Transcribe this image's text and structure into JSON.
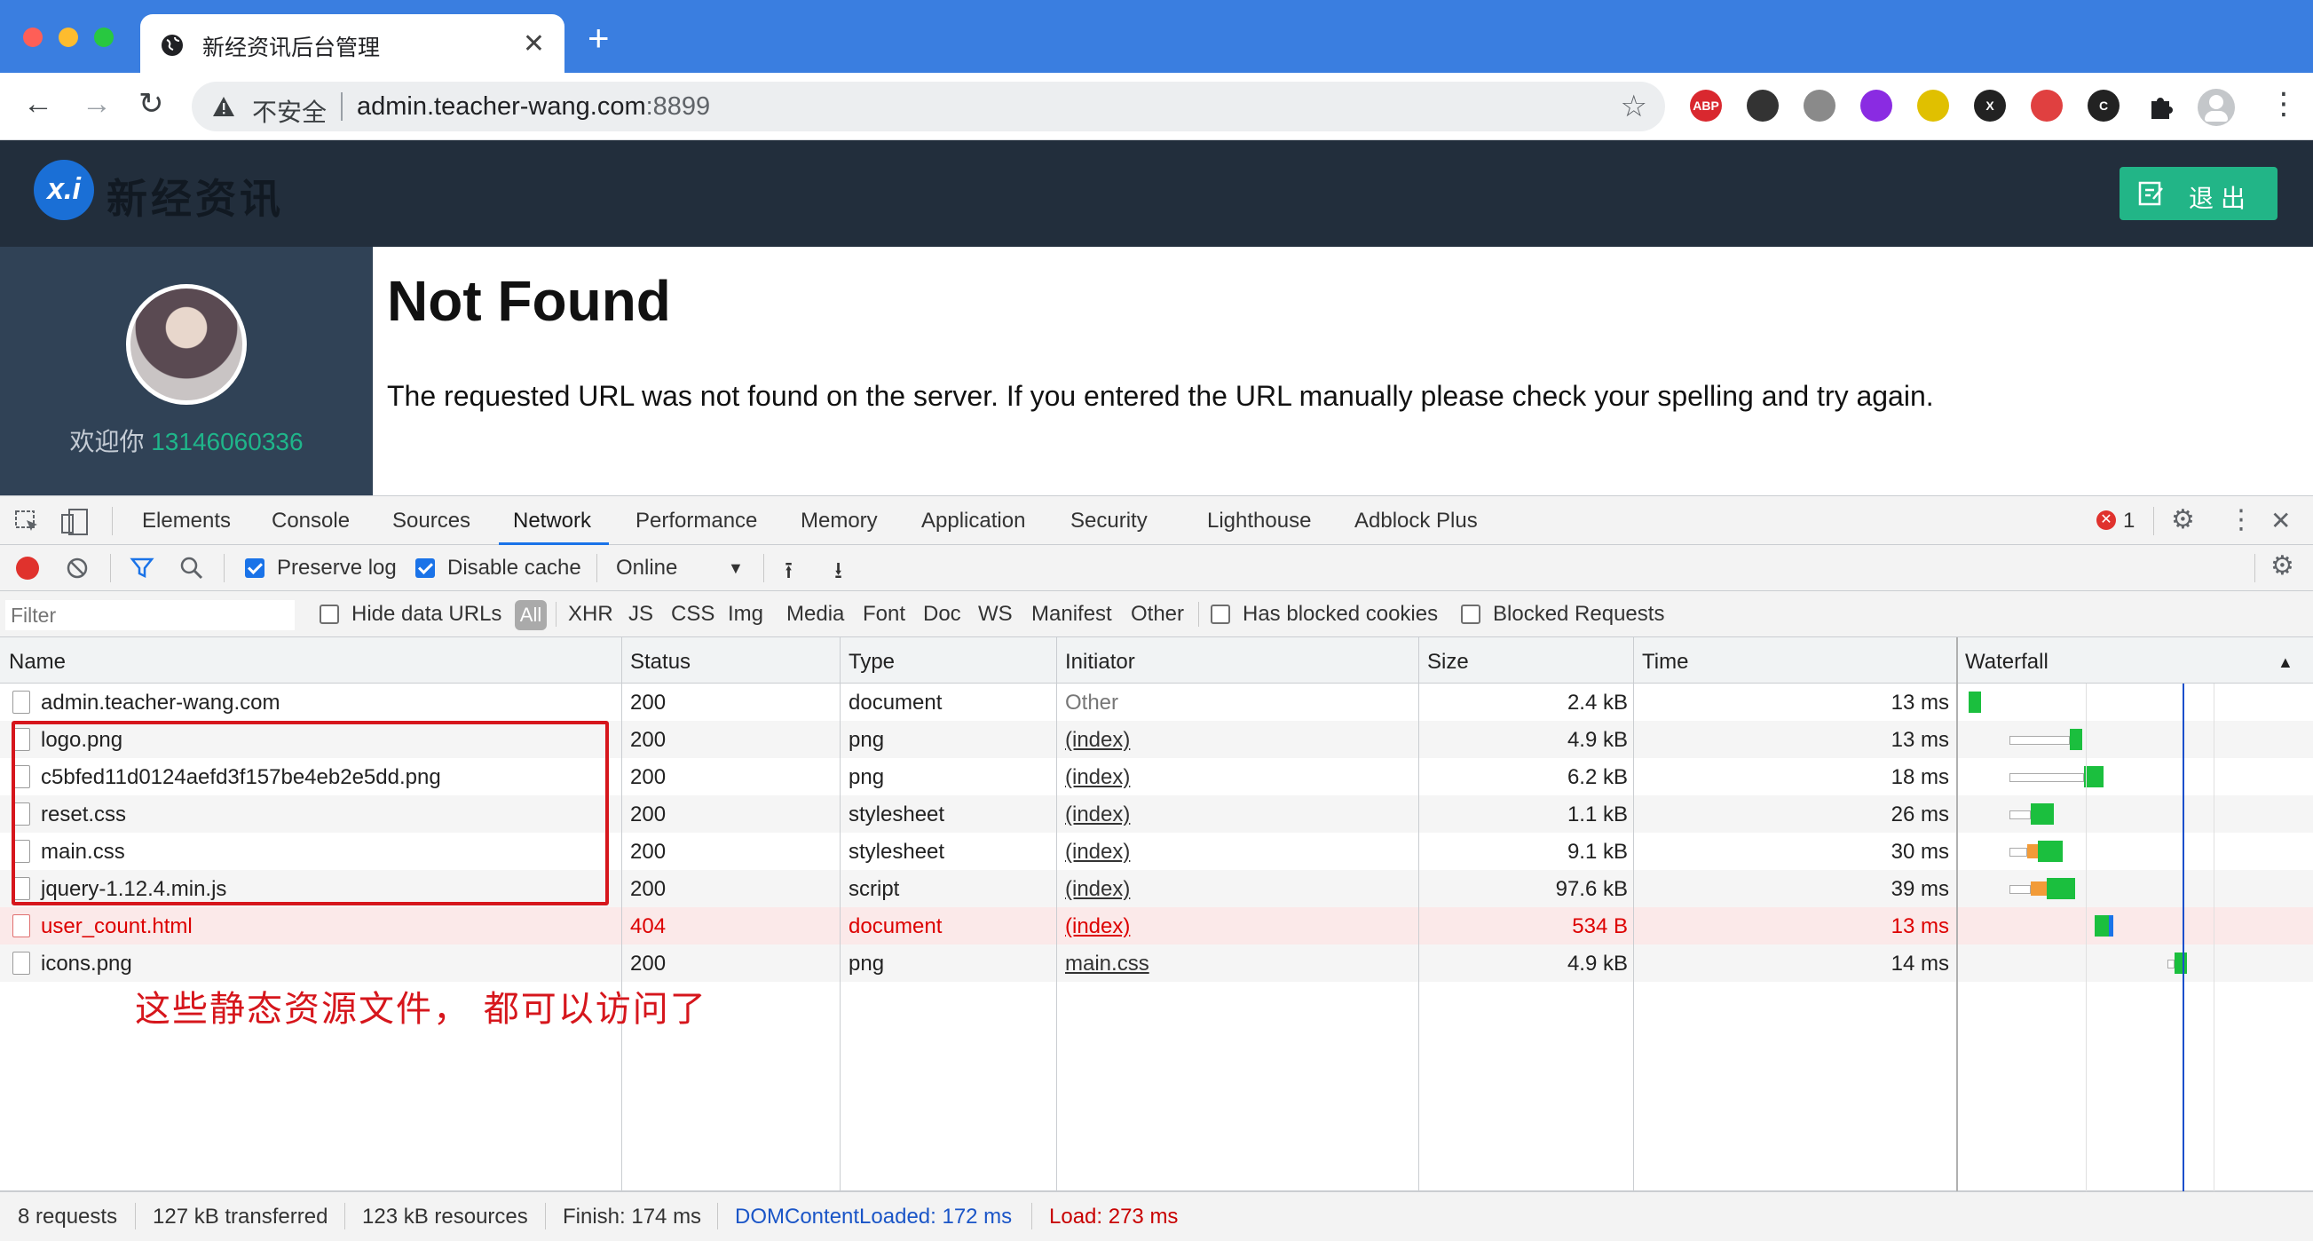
{
  "browser": {
    "tab_title": "新经资讯后台管理",
    "new_tab": "+",
    "insecure_label": "不安全",
    "url_host": "admin.teacher-wang.com",
    "url_port": ":8899",
    "extensions": [
      {
        "name": "adblock-plus-icon",
        "text": "ABP",
        "color": "#d9282f"
      },
      {
        "name": "qr-code-icon",
        "text": "",
        "color": "#333333"
      },
      {
        "name": "globe-extension-icon",
        "text": "",
        "color": "#8a8a8a"
      },
      {
        "name": "purple-extension-icon",
        "text": "",
        "color": "#8a2be2"
      },
      {
        "name": "lightning-extension-icon",
        "text": "",
        "color": "#e0c000"
      },
      {
        "name": "x-extension-icon",
        "text": "X",
        "color": "#222222"
      },
      {
        "name": "translate-extension-icon",
        "text": "",
        "color": "#e04040"
      },
      {
        "name": "c-extension-icon",
        "text": "C",
        "color": "#222222"
      }
    ]
  },
  "site": {
    "logo_badge": "x.i",
    "logo_text": "新经资讯",
    "logout_label": "退出",
    "welcome_prefix": "欢迎你 ",
    "welcome_phone": "13146060336",
    "error_title": "Not Found",
    "error_message": "The requested URL was not found on the server. If you entered the URL manually please check your spelling and try again."
  },
  "devtools": {
    "tabs": [
      "Elements",
      "Console",
      "Sources",
      "Network",
      "Performance",
      "Memory",
      "Application",
      "Security",
      "Lighthouse",
      "Adblock Plus"
    ],
    "active_tab": "Network",
    "error_count": "1",
    "toolbar": {
      "preserve_log": "Preserve log",
      "disable_cache": "Disable cache",
      "throttle": "Online"
    },
    "filter": {
      "placeholder": "Filter",
      "hide_data_urls": "Hide data URLs",
      "all": "All",
      "types": [
        "XHR",
        "JS",
        "CSS",
        "Img",
        "Media",
        "Font",
        "Doc",
        "WS",
        "Manifest",
        "Other"
      ],
      "has_blocked_cookies": "Has blocked cookies",
      "blocked_requests": "Blocked Requests"
    },
    "columns": [
      "Name",
      "Status",
      "Type",
      "Initiator",
      "Size",
      "Time",
      "Waterfall"
    ],
    "requests": [
      {
        "name": "admin.teacher-wang.com",
        "status": "200",
        "type": "document",
        "initiator": "Other",
        "size": "2.4 kB",
        "time": "13 ms"
      },
      {
        "name": "logo.png",
        "status": "200",
        "type": "png",
        "initiator": "(index)",
        "size": "4.9 kB",
        "time": "13 ms"
      },
      {
        "name": "c5bfed11d0124aefd3f157be4eb2e5dd.png",
        "status": "200",
        "type": "png",
        "initiator": "(index)",
        "size": "6.2 kB",
        "time": "18 ms"
      },
      {
        "name": "reset.css",
        "status": "200",
        "type": "stylesheet",
        "initiator": "(index)",
        "size": "1.1 kB",
        "time": "26 ms"
      },
      {
        "name": "main.css",
        "status": "200",
        "type": "stylesheet",
        "initiator": "(index)",
        "size": "9.1 kB",
        "time": "30 ms"
      },
      {
        "name": "jquery-1.12.4.min.js",
        "status": "200",
        "type": "script",
        "initiator": "(index)",
        "size": "97.6 kB",
        "time": "39 ms"
      },
      {
        "name": "user_count.html",
        "status": "404",
        "type": "document",
        "initiator": "(index)",
        "size": "534 B",
        "time": "13 ms"
      },
      {
        "name": "icons.png",
        "status": "200",
        "type": "png",
        "initiator": "main.css",
        "size": "4.9 kB",
        "time": "14 ms"
      }
    ],
    "annotation": "这些静态资源文件， 都可以访问了",
    "status_bar": {
      "requests": "8 requests",
      "transferred": "127 kB transferred",
      "resources": "123 kB resources",
      "finish": "Finish: 174 ms",
      "dom_content_loaded": "DOMContentLoaded: 172 ms",
      "load": "Load: 273 ms"
    },
    "colors": {
      "dcl": "#1a55c7",
      "load": "#c80000",
      "error": "#dd0000"
    }
  }
}
